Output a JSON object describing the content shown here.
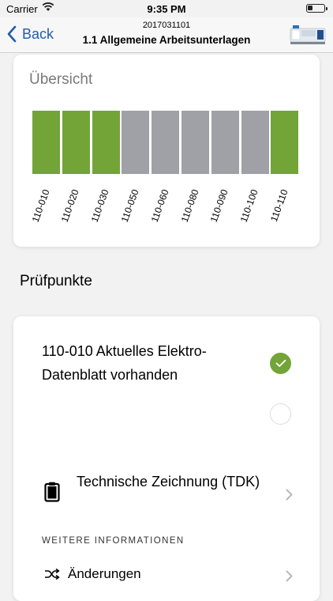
{
  "status": {
    "carrier": "Carrier",
    "time": "9:35 PM"
  },
  "nav": {
    "back_label": "Back",
    "subtitle": "2017031101",
    "title": "1.1 Allgemeine Arbeitsunterlagen"
  },
  "overview": {
    "title": "Übersicht",
    "colors": {
      "done": "#73a438",
      "open": "#a0a1a6"
    },
    "items": [
      {
        "label": "110-010",
        "status": "done"
      },
      {
        "label": "110-020",
        "status": "done"
      },
      {
        "label": "110-030",
        "status": "done"
      },
      {
        "label": "110-050",
        "status": "open"
      },
      {
        "label": "110-060",
        "status": "open"
      },
      {
        "label": "110-080",
        "status": "open"
      },
      {
        "label": "110-090",
        "status": "open"
      },
      {
        "label": "110-100",
        "status": "open"
      },
      {
        "label": "110-110",
        "status": "done"
      }
    ]
  },
  "section_title": "Prüfpunkte",
  "point": {
    "text": "110-010 Aktuelles Elektro-Datenblatt vorhanden",
    "doc_label": "Technische Zeichnung (TDK)",
    "info_header": "WEITERE INFORMATIONEN",
    "changes_label": "Änderungen"
  }
}
